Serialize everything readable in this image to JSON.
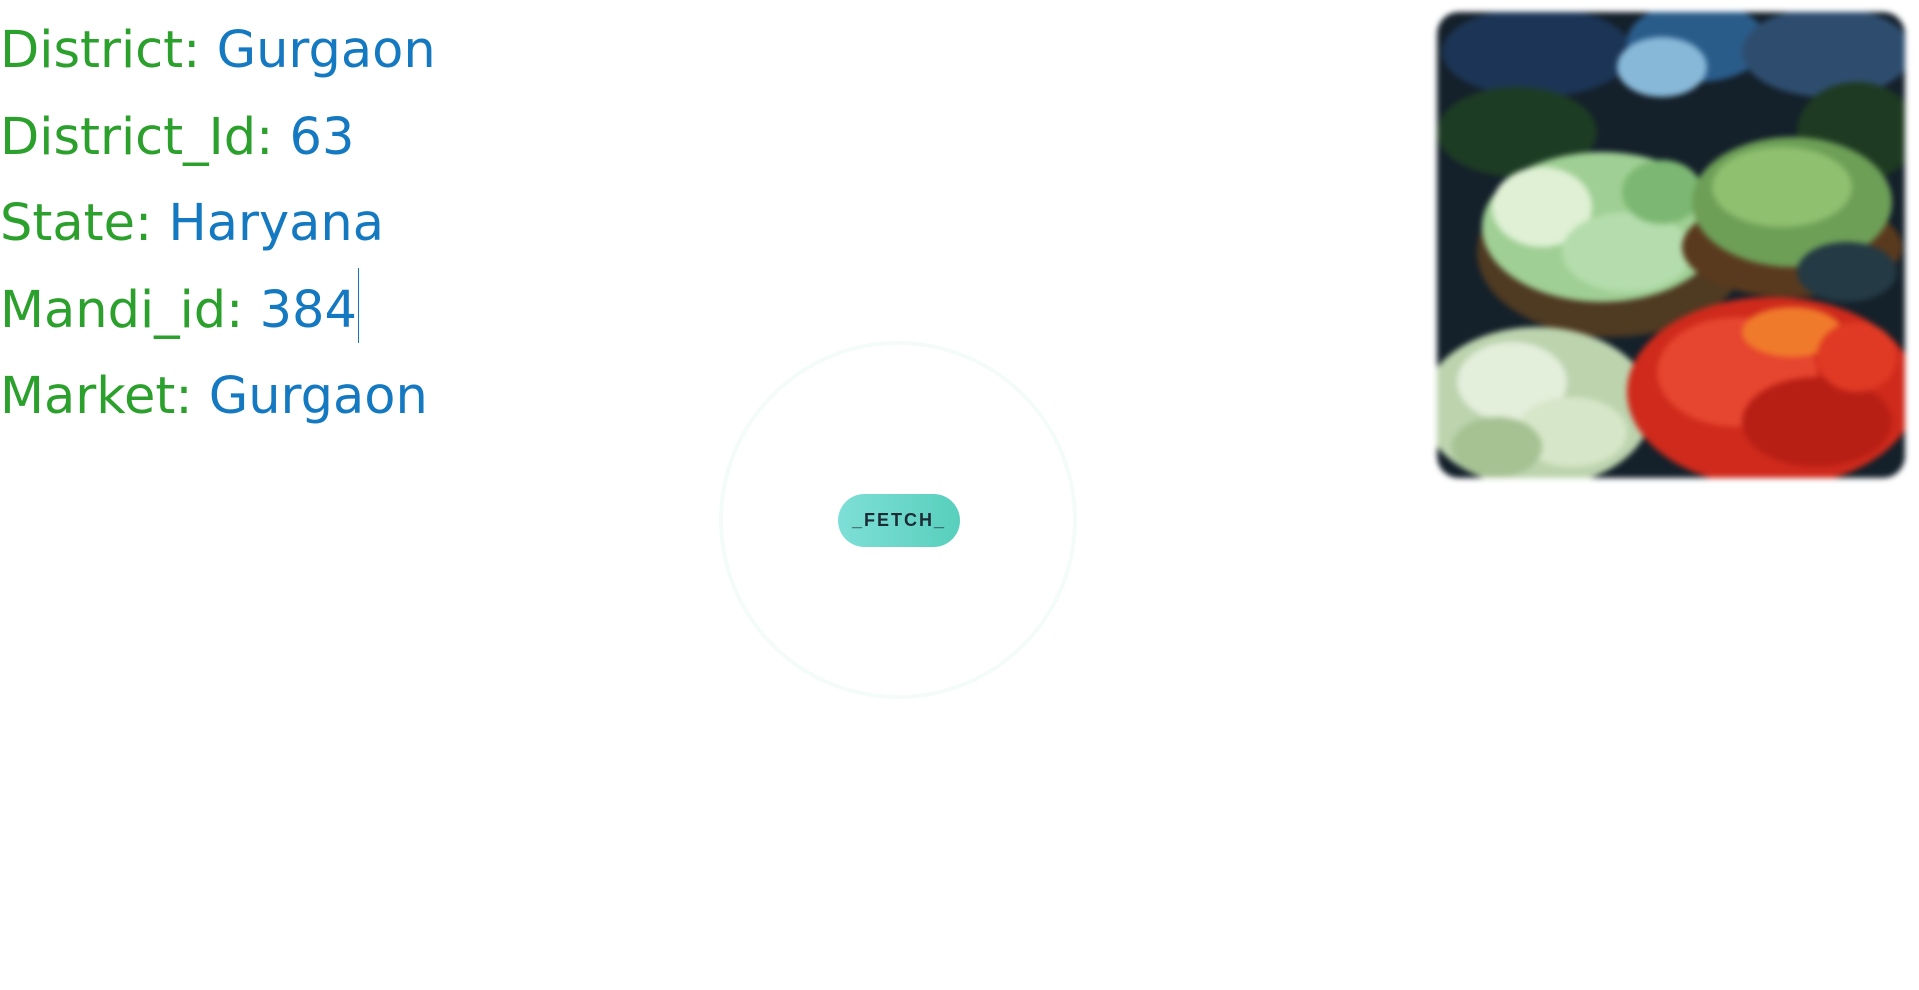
{
  "fields": [
    {
      "label": "District:",
      "value": "Gurgaon"
    },
    {
      "label": "District_Id:",
      "value": "63"
    },
    {
      "label": "State:",
      "value": "Haryana"
    },
    {
      "label": "Mandi_id:",
      "value": "384"
    },
    {
      "label": "Market:",
      "value": "Gurgaon"
    }
  ],
  "fetch_button": {
    "label": "_FETCH_"
  },
  "colors": {
    "label": "#2ca02c",
    "value": "#1479c0",
    "button_start": "#7edfd7",
    "button_end": "#58cfbd"
  }
}
